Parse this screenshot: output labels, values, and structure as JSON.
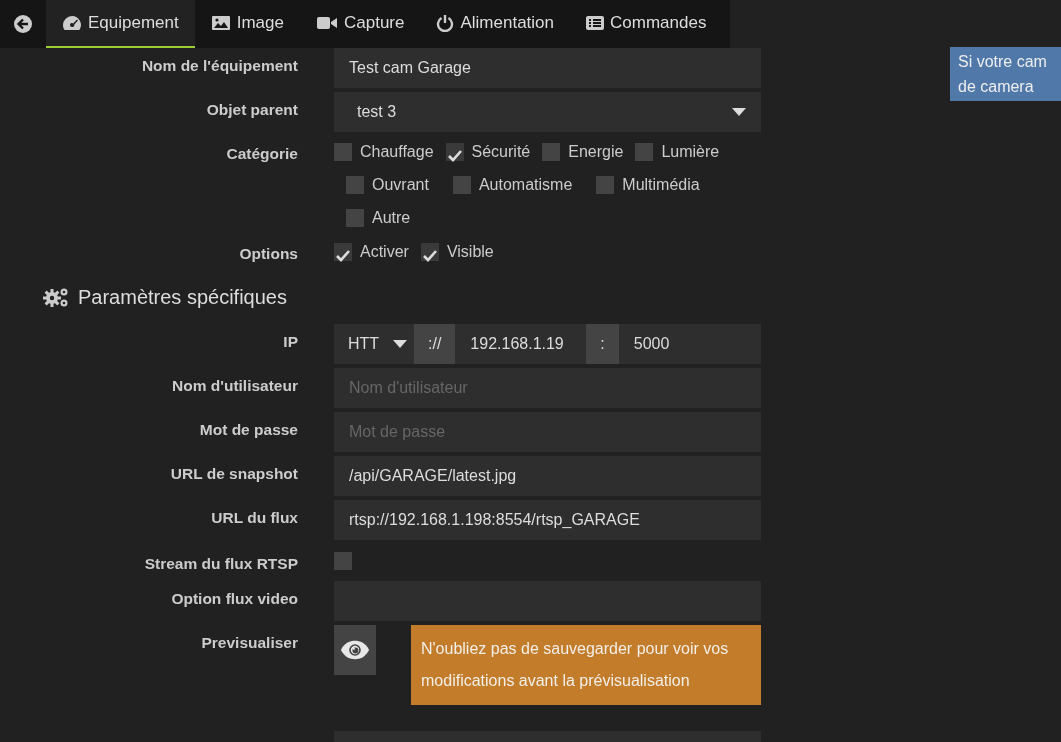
{
  "tabs": [
    {
      "label": "Equipement",
      "kind": "gauge",
      "selected": true
    },
    {
      "label": "Image",
      "kind": "image",
      "selected": false
    },
    {
      "label": "Capture",
      "kind": "video",
      "selected": false
    },
    {
      "label": "Alimentation",
      "kind": "power",
      "selected": false
    },
    {
      "label": "Commandes",
      "kind": "list",
      "selected": false
    }
  ],
  "info_note": "Si votre cam\nde camera",
  "form": [
    {
      "kind": "text",
      "label": "Nom de l'équipement",
      "value": "Test cam Garage"
    },
    {
      "kind": "select",
      "label": "Objet parent",
      "value": "test 3"
    },
    {
      "kind": "checks",
      "label": "Catégorie",
      "options": [
        {
          "label": "Chauffage",
          "checked": false
        },
        {
          "label": "Sécurité",
          "checked": true
        },
        {
          "label": "Energie",
          "checked": false
        },
        {
          "label": "Lumière",
          "checked": false
        },
        {
          "label": "Ouvrant",
          "checked": false
        },
        {
          "label": "Automatisme",
          "checked": false
        },
        {
          "label": "Multimédia",
          "checked": false
        },
        {
          "label": "Autre",
          "checked": false
        }
      ]
    },
    {
      "kind": "checks",
      "label": "Options",
      "options": [
        {
          "label": "Activer",
          "checked": true
        },
        {
          "label": "Visible",
          "checked": true
        }
      ]
    },
    {
      "kind": "heading",
      "label": "Paramètres spécifiques"
    },
    {
      "kind": "ip",
      "label": "IP",
      "protocol": "HTT",
      "separator": "://",
      "host": "192.168.1.19",
      "colon": ":",
      "port": "5000"
    },
    {
      "kind": "text",
      "label": "Nom d'utilisateur",
      "placeholder": "Nom d'utilisateur"
    },
    {
      "kind": "text",
      "label": "Mot de passe",
      "placeholder": "Mot de passe"
    },
    {
      "kind": "text",
      "label": "URL de snapshot",
      "value": "/api/GARAGE/latest.jpg"
    },
    {
      "kind": "text",
      "label": "URL du flux",
      "value": "rtsp://192.168.1.198:8554/rtsp_GARAGE"
    },
    {
      "kind": "checkbox",
      "label": "Stream du flux RTSP",
      "checked": false
    },
    {
      "kind": "text",
      "label": "Option flux video"
    },
    {
      "kind": "preview",
      "label": "Previsualiser",
      "note": "N'oubliez pas de sauvegarder pour voir vos modifications avant la prévisualisation"
    },
    {
      "kind": "text"
    }
  ]
}
